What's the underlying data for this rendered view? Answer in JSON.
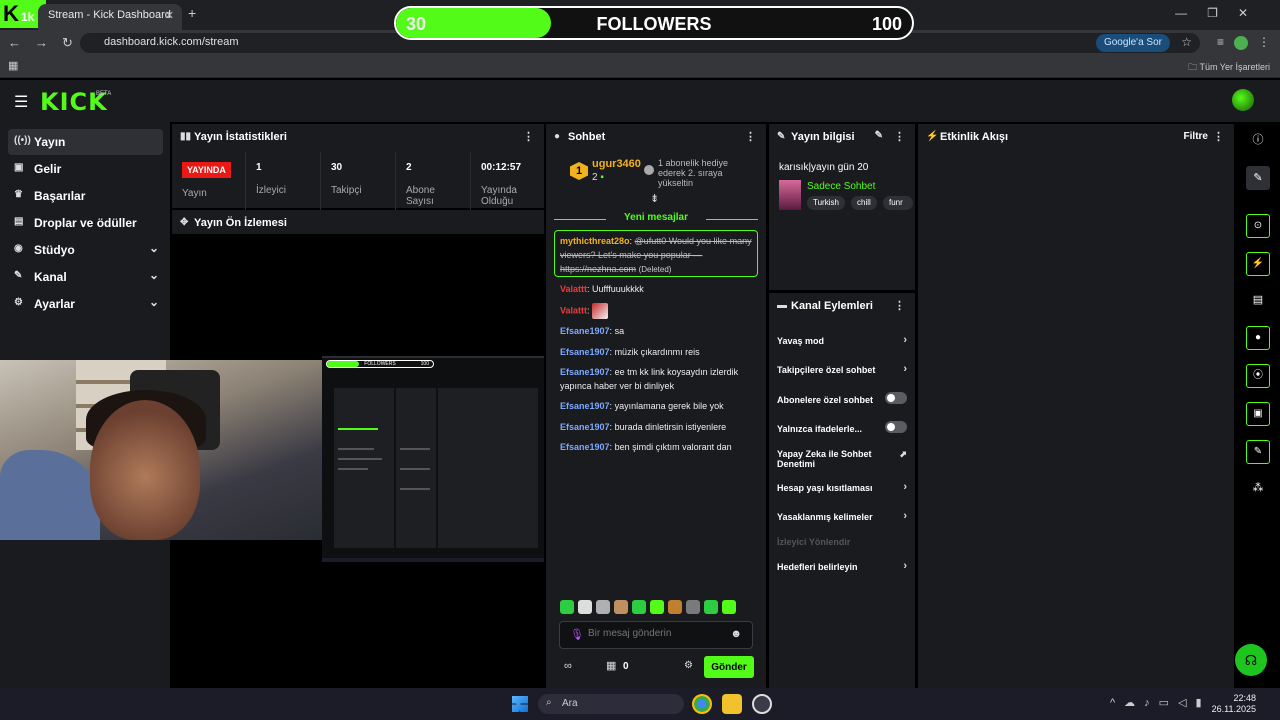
{
  "browser": {
    "tab_title": "Stream - Kick Dashboard",
    "tab_favicon_text": "1k",
    "url": "dashboard.kick.com/stream",
    "google_btn": "Google'a Sor",
    "bookmarks_all": "Tüm Yer İşaretleri"
  },
  "overlay": {
    "current": "30",
    "label": "FOLLOWERS",
    "goal": "100",
    "progress": 0.3
  },
  "header": {
    "logo": "KICK",
    "beta": "BETA"
  },
  "sidebar": {
    "items": [
      {
        "label": "Yayın",
        "icon": "broadcast-icon"
      },
      {
        "label": "Gelir",
        "icon": "revenue-icon"
      },
      {
        "label": "Başarılar",
        "icon": "trophy-icon"
      },
      {
        "label": "Droplar ve ödüller",
        "icon": "gift-icon"
      },
      {
        "label": "Stüdyo",
        "icon": "studio-icon"
      },
      {
        "label": "Kanal",
        "icon": "channel-icon"
      },
      {
        "label": "Ayarlar",
        "icon": "settings-icon"
      }
    ]
  },
  "stats": {
    "title": "Yayın İstatistikleri",
    "live_badge": "YAYINDA",
    "items": [
      {
        "value": "",
        "label": "Yayın"
      },
      {
        "value": "1",
        "label": "İzleyici"
      },
      {
        "value": "30",
        "label": "Takipçi"
      },
      {
        "value": "2",
        "label": "Abone Sayısı"
      },
      {
        "value": "00:12:57",
        "label": "Yayında Olduğu"
      }
    ]
  },
  "preview": {
    "title": "Yayın Ön İzlemesi",
    "mini_followers": "FOLLOWERS",
    "mini_goal": "100"
  },
  "chat": {
    "title": "Sohbet",
    "pinned": {
      "user": "ugur3460",
      "rank": "1",
      "count": "2",
      "text": "1 abonelik hediye ederek 2. sıraya yükseltin"
    },
    "new_messages": "Yeni mesajlar",
    "highlight": {
      "user": "mythicthreat28o",
      "text": "@ufutt0 Would you like many viewers? Let's make you popular — https://nezhna.com",
      "deleted": "(Deleted)"
    },
    "messages": [
      {
        "user": "Valattt",
        "text": "Uufffuuukkkk",
        "color": "red"
      },
      {
        "user": "Valattt",
        "text": "",
        "color": "red",
        "emote": true
      },
      {
        "user": "Efsane1907",
        "text": "sa",
        "color": "blue"
      },
      {
        "user": "Efsane1907",
        "text": "müzik çıkardınmı reis",
        "color": "blue"
      },
      {
        "user": "Efsane1907",
        "text": "ee tm kk link koysaydın izlerdik yapınca haber ver bi dinliyek",
        "color": "blue"
      },
      {
        "user": "Efsane1907",
        "text": "yayınlamana gerek bile yok",
        "color": "blue"
      },
      {
        "user": "Efsane1907",
        "text": "burada dinletirsin istiyenlere",
        "color": "blue"
      },
      {
        "user": "Efsane1907",
        "text": "ben şimdi çıktım valorant dan",
        "color": "blue"
      }
    ],
    "emote_colors": [
      "#2ecc40",
      "#dddddd",
      "#b0b0b0",
      "#c09060",
      "#2ecc40",
      "#53fc18",
      "#c08030",
      "#7a7a7a",
      "#2ecc40",
      "#53fc18"
    ],
    "input_placeholder": "Bir mesaj gönderin",
    "coin_count": "0",
    "send": "Gönder"
  },
  "stream_info": {
    "title": "Yayın bilgisi",
    "stream_title": "karısık|yayın gün 20",
    "category": "Sadece Sohbet",
    "tags": [
      "Turkish",
      "chill",
      "funr"
    ]
  },
  "channel_actions": {
    "title": "Kanal Eylemleri",
    "items": [
      {
        "label": "Yavaş mod",
        "kind": "chevron"
      },
      {
        "label": "Takipçilere özel sohbet",
        "kind": "chevron"
      },
      {
        "label": "Abonelere özel sohbet",
        "kind": "toggle"
      },
      {
        "label": "Yalnızca ifadelerle...",
        "kind": "toggle"
      },
      {
        "label": "Yapay Zeka ile Sohbet Denetimi",
        "kind": "external"
      },
      {
        "label": "Hesap yaşı kısıtlaması",
        "kind": "chevron"
      },
      {
        "label": "Yasaklanmış kelimeler",
        "kind": "chevron"
      },
      {
        "label": "İzleyici Yönlendir",
        "kind": "disabled"
      },
      {
        "label": "Hedefleri belirleyin",
        "kind": "chevron"
      }
    ]
  },
  "activity": {
    "title": "Etkinlik Akışı",
    "filter": "Filtre"
  },
  "taskbar": {
    "search": "Ara",
    "time": "22:48",
    "date": "26.11.2025"
  },
  "colors": {
    "accent": "#53fc18",
    "live": "#e91916",
    "panel": "#191b1f"
  }
}
